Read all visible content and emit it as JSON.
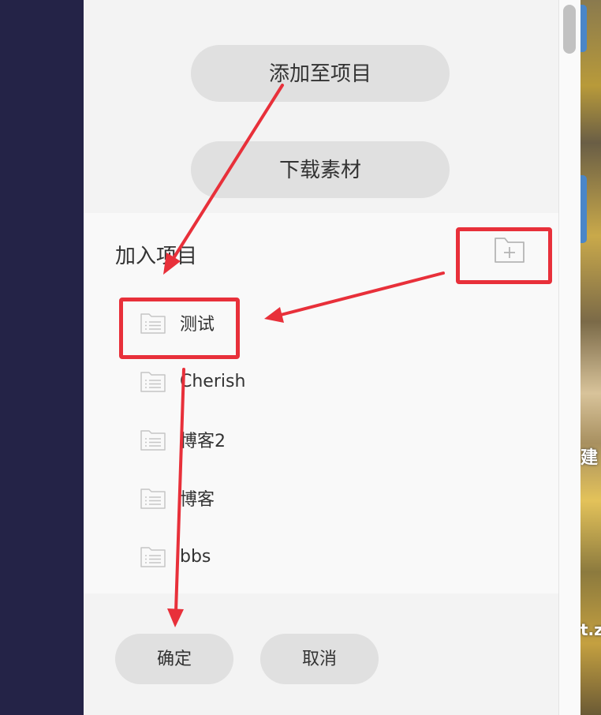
{
  "actions": {
    "add_to_project": "添加至项目",
    "download_material": "下载素材"
  },
  "dialog": {
    "title": "加入项目",
    "new_folder_icon": "folder-plus-icon",
    "projects": [
      {
        "label": "测试",
        "icon": "folder-list-icon"
      },
      {
        "label": "Cherish",
        "icon": "folder-list-icon"
      },
      {
        "label": "博客2",
        "icon": "folder-list-icon"
      },
      {
        "label": "博客",
        "icon": "folder-list-icon"
      },
      {
        "label": "bbs",
        "icon": "folder-list-icon"
      }
    ],
    "confirm_label": "确定",
    "cancel_label": "取消"
  },
  "background": {
    "partial_text_1": "建",
    "partial_text_2": "t.z"
  },
  "colors": {
    "annotation": "#e8303a",
    "left_strip": "#242347",
    "button_bg": "#e0e0e0"
  }
}
